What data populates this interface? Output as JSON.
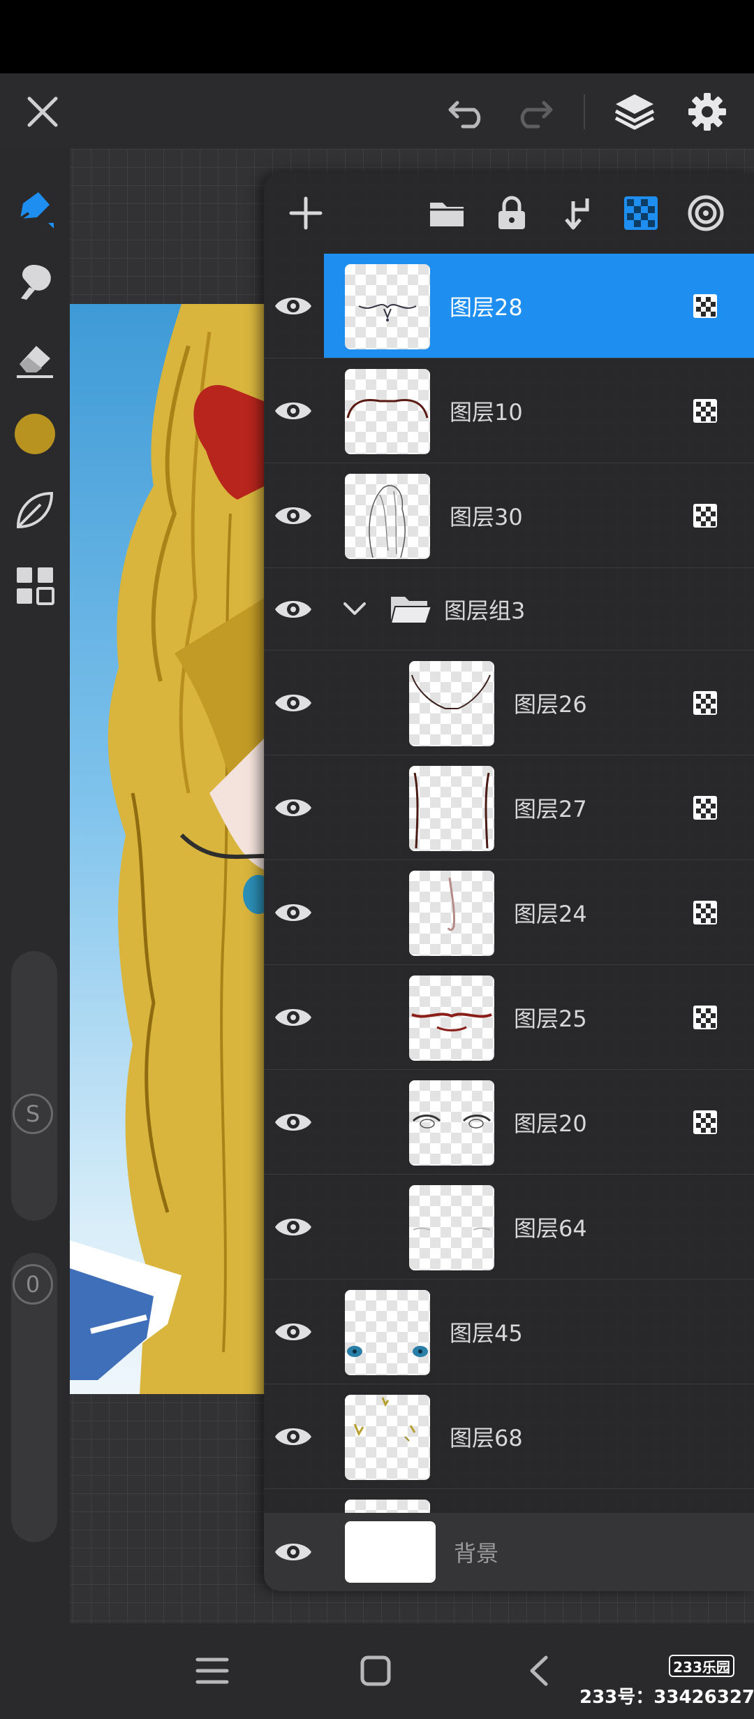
{
  "topbar": {
    "close_icon": "close-icon",
    "undo_icon": "undo-icon",
    "redo_icon": "redo-icon",
    "layers_icon": "layers-icon",
    "settings_icon": "gear-icon"
  },
  "toolbar": {
    "tools": [
      "brush-icon",
      "smudge-icon",
      "eraser-icon",
      "color-swatch",
      "leaf-icon",
      "grid-icon"
    ],
    "active_color": "#b8931f",
    "accent_color": "#1e8ff0",
    "size_label": "S",
    "opacity_label": "0"
  },
  "panel_header": {
    "buttons": [
      "add-icon",
      "folder-icon",
      "lock-icon",
      "merge-down-icon",
      "alpha-lock-icon",
      "blend-mode-icon"
    ]
  },
  "layers": [
    {
      "name": "图层28",
      "selected": true,
      "alpha_lock": true,
      "indent": false
    },
    {
      "name": "图层10",
      "selected": false,
      "alpha_lock": true,
      "indent": false
    },
    {
      "name": "图层30",
      "selected": false,
      "alpha_lock": true,
      "indent": false
    },
    {
      "name": "图层组3",
      "type": "group",
      "expanded": true
    },
    {
      "name": "图层26",
      "selected": false,
      "alpha_lock": true,
      "indent": true
    },
    {
      "name": "图层27",
      "selected": false,
      "alpha_lock": true,
      "indent": true
    },
    {
      "name": "图层24",
      "selected": false,
      "alpha_lock": true,
      "indent": true
    },
    {
      "name": "图层25",
      "selected": false,
      "alpha_lock": true,
      "indent": true
    },
    {
      "name": "图层20",
      "selected": false,
      "alpha_lock": true,
      "indent": true
    },
    {
      "name": "图层64",
      "selected": false,
      "alpha_lock": false,
      "indent": true
    },
    {
      "name": "图层45",
      "selected": false,
      "alpha_lock": false,
      "indent": false
    },
    {
      "name": "图层68",
      "selected": false,
      "alpha_lock": false,
      "indent": false
    }
  ],
  "background_layer": {
    "name": "背景"
  },
  "selection_color": "#1e8ff0",
  "navbar": {
    "menu_icon": "menu-icon",
    "home_icon": "home-icon",
    "back_icon": "back-icon"
  },
  "watermark": {
    "logo": "233乐园",
    "text": "233号：33426327"
  }
}
